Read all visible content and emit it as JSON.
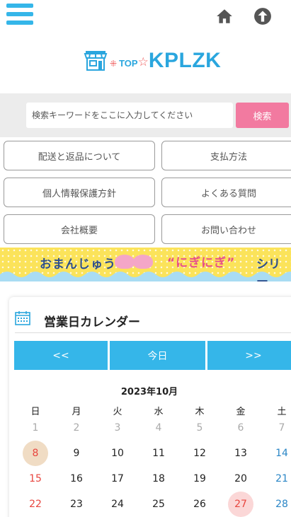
{
  "header": {
    "menu_icon": "hamburger-menu-icon",
    "home_icon": "home-icon",
    "up_icon": "arrow-up-circle-icon"
  },
  "logo": {
    "icon": "shop-storefront-icon",
    "top_label": "TOP",
    "star": "☆",
    "name": "KPLZK"
  },
  "search": {
    "placeholder": "検索キーワードをここに入力してください",
    "button_label": "検索"
  },
  "nav": {
    "shipping": "配送と返品について",
    "payment": "支払方法",
    "privacy": "個人情報保護方針",
    "faq": "よくある質問",
    "company": "会社概要",
    "contact": "お問い合わせ"
  },
  "banner": {
    "text1": "おまんじゅう",
    "text2": "“にぎにぎ”",
    "text3": "シリー"
  },
  "calendar": {
    "icon": "calendar-icon",
    "title": "営業日カレンダー",
    "prev": "<<",
    "today_label": "今日",
    "next": ">>",
    "month": "2023年10月",
    "weekdays": [
      "日",
      "月",
      "火",
      "水",
      "木",
      "金",
      "土"
    ],
    "week1": [
      "1",
      "2",
      "3",
      "4",
      "5",
      "6",
      "7"
    ],
    "week2": [
      "8",
      "9",
      "10",
      "11",
      "12",
      "13",
      "14"
    ],
    "week3": [
      "15",
      "16",
      "17",
      "18",
      "19",
      "20",
      "21"
    ],
    "week4": [
      "22",
      "23",
      "24",
      "25",
      "26",
      "27",
      "28"
    ]
  },
  "colors": {
    "accent": "#35b6e9",
    "search_button": "#f27aa0",
    "today_highlight": "#f0dcc4",
    "holiday_highlight": "#fbd7d7",
    "sunday": "#e8463f",
    "saturday": "#2a86c6"
  }
}
